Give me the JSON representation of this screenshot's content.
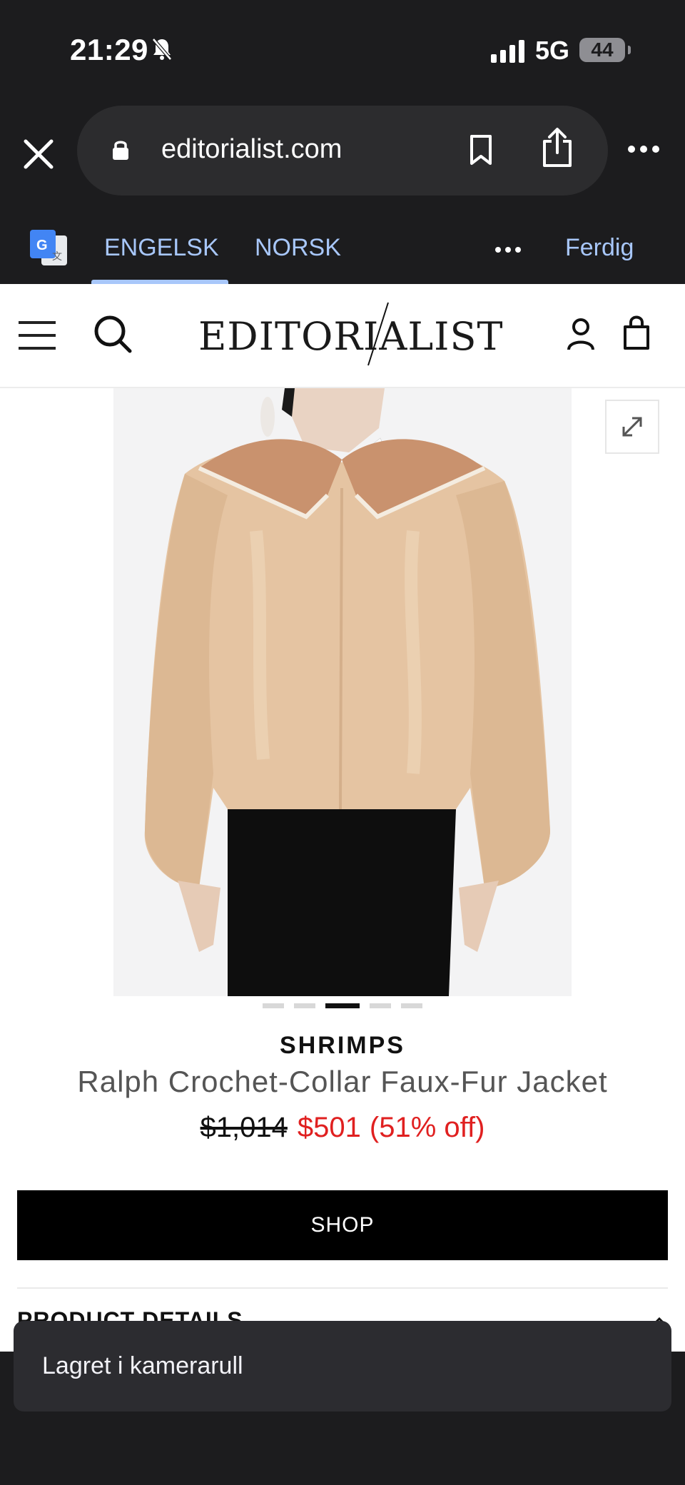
{
  "status_bar": {
    "time": "21:29",
    "network": "5G",
    "battery": "44"
  },
  "browser": {
    "url": "editorialist.com"
  },
  "translate_bar": {
    "tab_english": "ENGELSK",
    "tab_norwegian": "NORSK",
    "done": "Ferdig"
  },
  "site": {
    "logo": "EDITORIALIST"
  },
  "product": {
    "brand": "SHRIMPS",
    "name": "Ralph Crochet-Collar Faux-Fur Jacket",
    "original_price": "$1,014",
    "sale_price": "$501",
    "discount": "(51% off)",
    "image_count": 5,
    "active_image": 3
  },
  "actions": {
    "shop_label": "SHOP",
    "details_label": "PRODUCT DETAILS"
  },
  "toast": {
    "message": "Lagret i kamerarull"
  },
  "colors": {
    "sale_red": "#e02020",
    "link_blue": "#a8c7fa",
    "chrome_dark": "#1c1c1e"
  }
}
